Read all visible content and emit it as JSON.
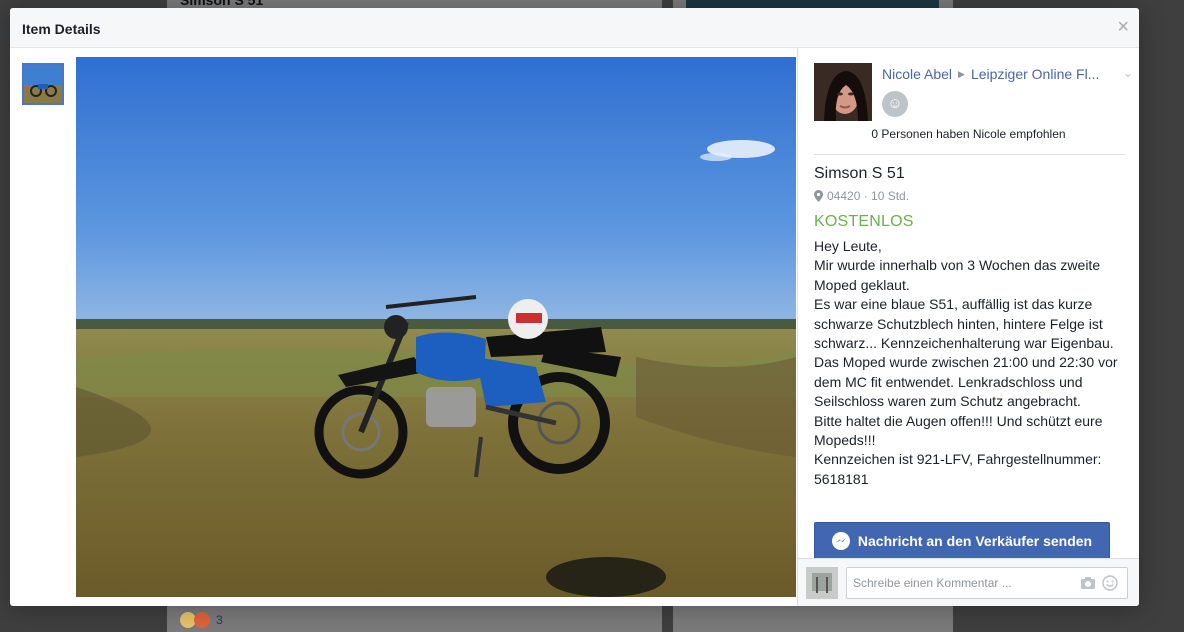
{
  "background": {
    "left_card_title": "Simson S 51",
    "reactions_count": "3"
  },
  "dialog": {
    "title": "Item Details",
    "close_label": "×"
  },
  "seller": {
    "name": "Nicole Abel",
    "group": "Leipziger Online Fl...",
    "recommendations": "0 Personen haben Nicole empfohlen"
  },
  "item": {
    "title": "Simson S 51",
    "location_time": "04420 · 10 Std.",
    "price": "KOSTENLOS",
    "description": [
      "Hey Leute,",
      "Mir wurde innerhalb von 3 Wochen das zweite Moped geklaut.",
      "Es war eine blaue S51, auffällig ist das kurze schwarze Schutzblech hinten, hintere Felge ist schwarz... Kennzeichenhalterung war Eigenbau.",
      "Das Moped wurde zwischen 21:00 und 22:30 vor dem MC fit entwendet. Lenkradschloss und Seilschloss waren zum Schutz angebracht.",
      "Bitte haltet die Augen offen!!! Und schützt eure Mopeds!!!",
      "Kennzeichen ist 921-LFV, Fahrgestellnummer: 5618181"
    ]
  },
  "actions": {
    "message_button": "Nachricht an den Verkäufer senden"
  },
  "comment": {
    "placeholder": "Schreibe einen Kommentar ..."
  },
  "colors": {
    "accent": "#4267b2",
    "price": "#6ab04c",
    "link": "#4b67a1"
  },
  "icons": [
    "close-icon",
    "map-pin-icon",
    "smiley-icon",
    "chevron-down-icon",
    "messenger-icon",
    "camera-icon",
    "emoji-icon"
  ]
}
